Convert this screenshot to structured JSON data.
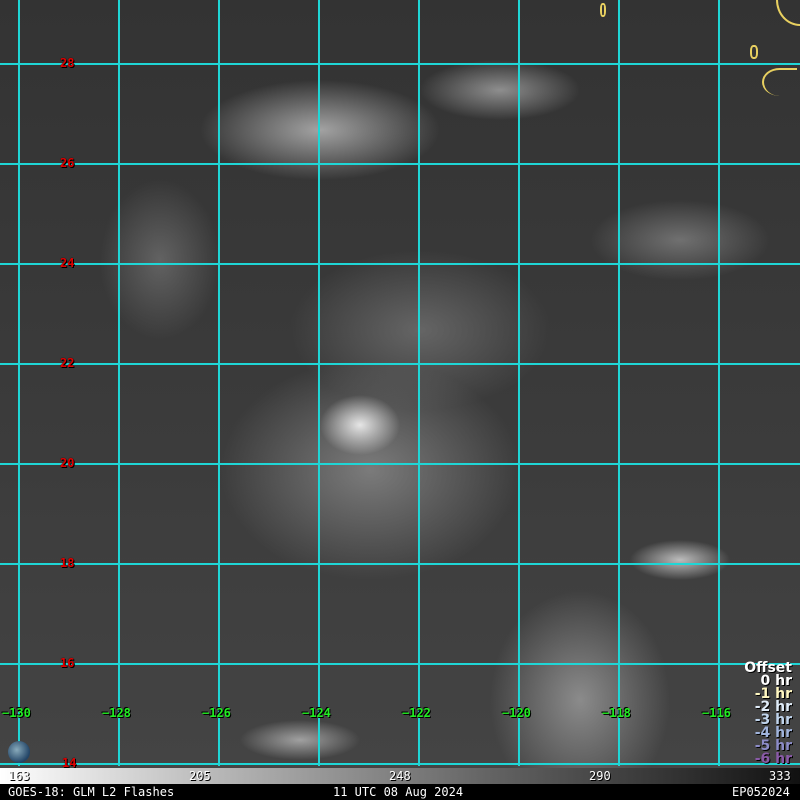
{
  "map": {
    "lat_labels": [
      "28",
      "26",
      "24",
      "22",
      "20",
      "18",
      "16",
      "14"
    ],
    "lon_labels": [
      "−130",
      "−128",
      "−126",
      "−124",
      "−122",
      "−120",
      "−118",
      "−116"
    ],
    "grid_color": "#1fd6d6"
  },
  "legend": {
    "title": "Offset",
    "items": [
      {
        "label": "0 hr",
        "color": "#ffffff"
      },
      {
        "label": "-1 hr",
        "color": "#fff7c0"
      },
      {
        "label": "-2 hr",
        "color": "#e0ecf8"
      },
      {
        "label": "-3 hr",
        "color": "#c0d4ec"
      },
      {
        "label": "-4 hr",
        "color": "#a0b4dc"
      },
      {
        "label": "-5 hr",
        "color": "#8c8cc8"
      },
      {
        "label": "-6 hr",
        "color": "#8a5aa8"
      }
    ]
  },
  "colorbar": {
    "ticks": [
      "163",
      "205",
      "248",
      "290",
      "333"
    ]
  },
  "footer": {
    "product": "GOES-18: GLM L2 Flashes",
    "time": "11 UTC 08 Aug 2024",
    "storm": "EP052024"
  },
  "logo": {
    "text": "CIRA"
  }
}
